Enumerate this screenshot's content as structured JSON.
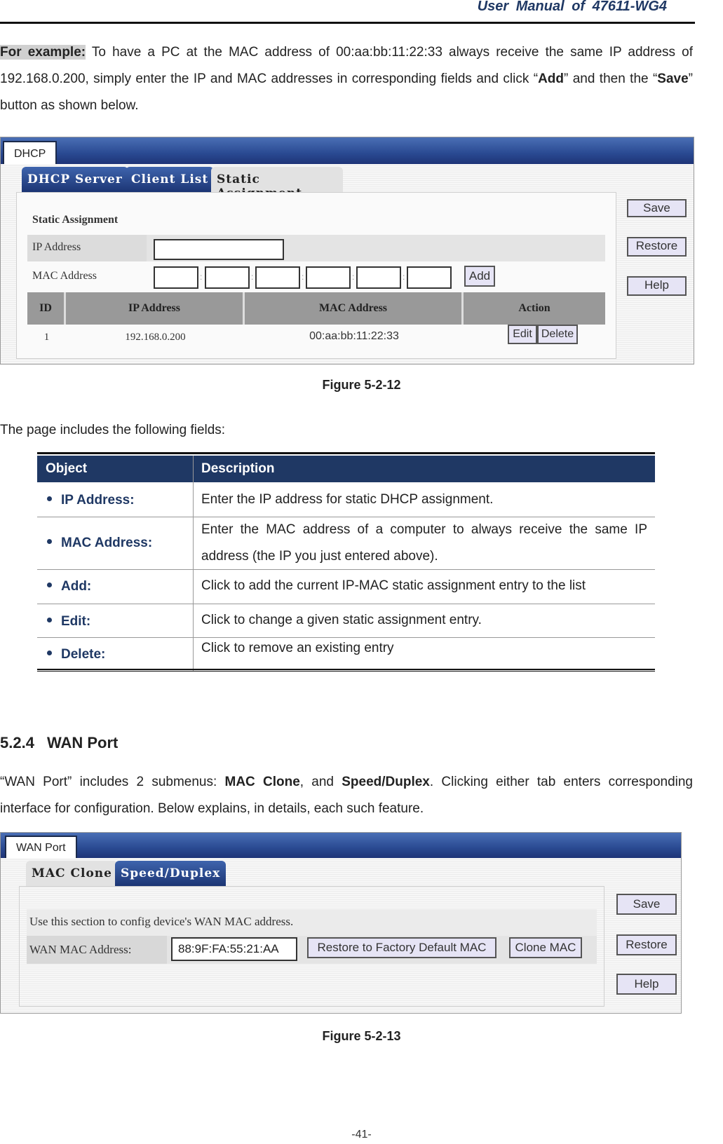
{
  "header": {
    "title": "User Manual of 47611-WG4"
  },
  "intro": {
    "highlight": "For example:",
    "text_1": " To have a PC at the MAC address of 00:aa:bb:11:22:33 always receive the same IP address of 192.168.0.200, simply enter the IP and MAC addresses in corresponding fields and click “",
    "bold_add": "Add",
    "text_2": "” and then the “",
    "bold_save": "Save",
    "text_3": "” button as shown below."
  },
  "figure1": {
    "window_tab": "DHCP",
    "tabs": [
      {
        "label": "DHCP Server",
        "active": false
      },
      {
        "label": "Client List",
        "active": false
      },
      {
        "label": "Static Assignment",
        "active": true
      }
    ],
    "section_title": "Static Assignment",
    "ip_label": "IP Address",
    "ip_value": "",
    "mac_label": "MAC Address",
    "mac_values": [
      "",
      "",
      "",
      "",
      "",
      ""
    ],
    "mac_separator": ":",
    "add_button": "Add",
    "table": {
      "headers": [
        "ID",
        "IP Address",
        "MAC Address",
        "Action"
      ],
      "rows": [
        {
          "id": "1",
          "ip": "192.168.0.200",
          "mac": "00:aa:bb:11:22:33",
          "edit": "Edit",
          "delete": "Delete"
        }
      ]
    },
    "side_buttons": [
      "Save",
      "Restore",
      "Help"
    ],
    "caption": "Figure 5-2-12"
  },
  "fields_intro": "The page includes the following fields:",
  "fields_table": {
    "headers": [
      "Object",
      "Description"
    ],
    "rows": [
      {
        "object": "IP Address:",
        "description": "Enter the IP address for static DHCP assignment."
      },
      {
        "object": "MAC Address:",
        "description": "Enter the MAC address of a computer to always receive the same IP address (the IP you just entered above)."
      },
      {
        "object": "Add:",
        "description": "Click to add the current IP-MAC static assignment entry to the list"
      },
      {
        "object": "Edit:",
        "description": "Click to change a given static assignment entry."
      },
      {
        "object": "Delete:",
        "description": "Click to remove an existing entry"
      }
    ]
  },
  "section": {
    "number": "5.2.4",
    "title": "WAN Port",
    "text_1": "“WAN Port” includes 2 submenus: ",
    "bold_1": "MAC Clone",
    "text_2": ", and ",
    "bold_2": "Speed/Duplex",
    "text_3": ". Clicking either tab enters corresponding interface for configuration. Below explains, in details, each such feature."
  },
  "figure2": {
    "window_tab": "WAN Port",
    "tabs": [
      {
        "label": "MAC Clone",
        "active": false
      },
      {
        "label": "Speed/Duplex",
        "active": true
      }
    ],
    "description": "Use this section to config device's WAN MAC address.",
    "wan_mac_label": "WAN MAC Address:",
    "wan_mac_value": "88:9F:FA:55:21:AA",
    "restore_default_button": "Restore to Factory Default MAC",
    "clone_button": "Clone MAC",
    "side_buttons": [
      "Save",
      "Restore",
      "Help"
    ],
    "caption": "Figure 5-2-13"
  },
  "page_number": "-41-"
}
